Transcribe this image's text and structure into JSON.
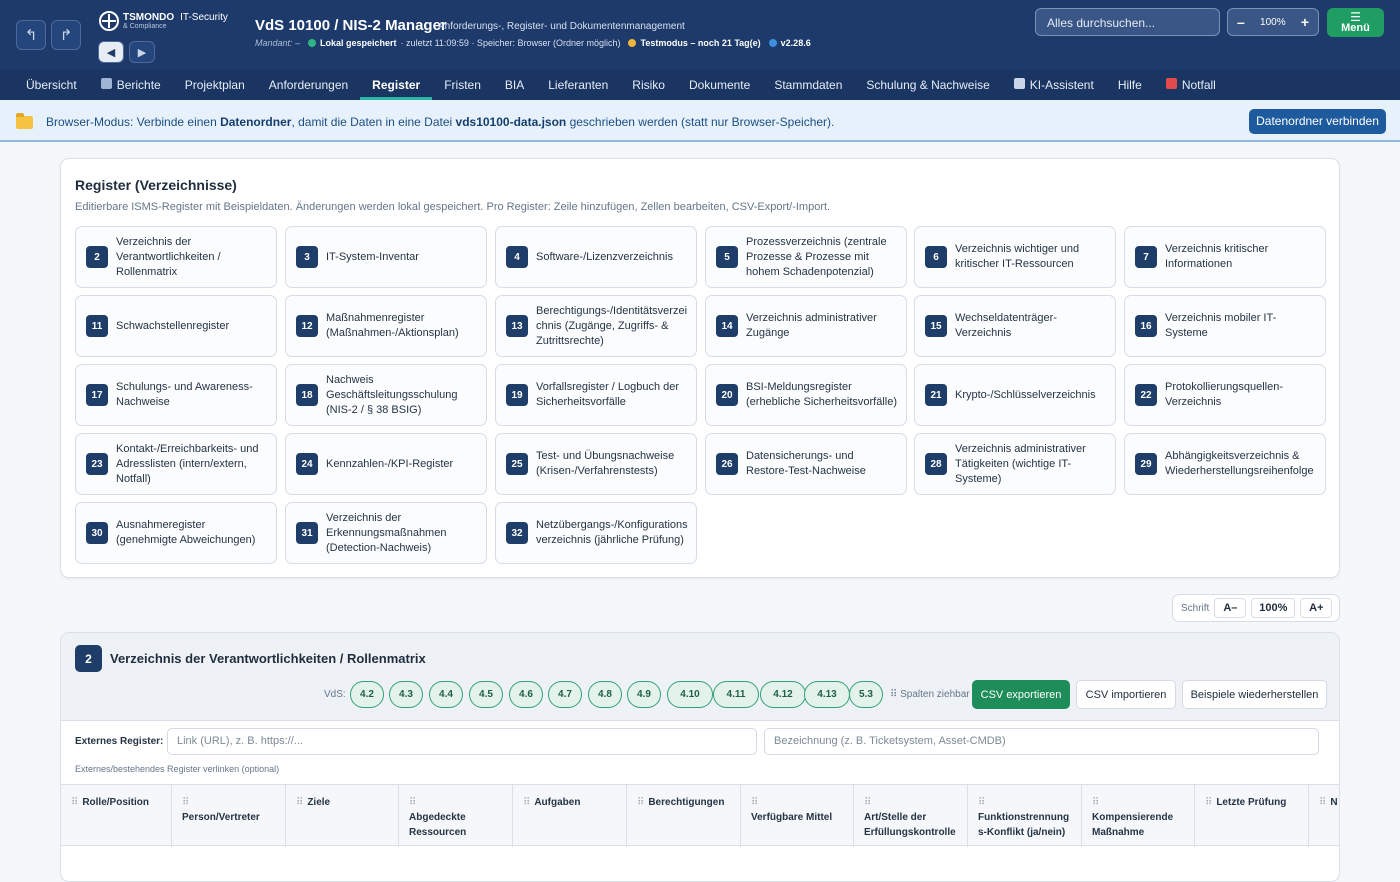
{
  "header": {
    "brand_name": "TSMONDO",
    "brand_suffix": "IT-Security",
    "brand_tagline": "& Compliance",
    "title": "VdS 10100 / NIS-2 Manager",
    "subtitle": "Anforderungs-, Register- und Dokumentenmanagement",
    "mandant": "Mandant: –",
    "status_saved": "Lokal gespeichert",
    "status_time": "· zuletzt 11:09:59 · Speicher: Browser (Ordner möglich)",
    "status_test": "Testmodus – noch 21 Tag(e)",
    "version": "v2.28.6",
    "search_placeholder": "Alles durchsuchen...",
    "zoom_minus": "–",
    "zoom_value": "100%",
    "zoom_plus": "+",
    "menu_label": "Menü",
    "colors": {
      "saved": "#2fb486",
      "test": "#f2b53c",
      "version": "#3f8fdc"
    }
  },
  "tabs": [
    {
      "label": "Übersicht",
      "icon": ""
    },
    {
      "label": "Berichte",
      "icon": "chart-icon"
    },
    {
      "label": "Projektplan",
      "icon": ""
    },
    {
      "label": "Anforderungen",
      "icon": ""
    },
    {
      "label": "Register",
      "icon": "",
      "active": true
    },
    {
      "label": "Fristen",
      "icon": ""
    },
    {
      "label": "BIA",
      "icon": ""
    },
    {
      "label": "Lieferanten",
      "icon": ""
    },
    {
      "label": "Risiko",
      "icon": ""
    },
    {
      "label": "Dokumente",
      "icon": ""
    },
    {
      "label": "Stammdaten",
      "icon": ""
    },
    {
      "label": "Schulung & Nachweise",
      "icon": ""
    },
    {
      "label": "KI-Assistent",
      "icon": "robot-icon"
    },
    {
      "label": "Hilfe",
      "icon": ""
    },
    {
      "label": "Notfall",
      "icon": "siren-icon"
    }
  ],
  "banner": {
    "text_1": "Browser-Modus: Verbinde einen ",
    "text_bold_1": "Datenordner",
    "text_2": ", damit die Daten in eine Datei ",
    "text_bold_2": "vds10100-data.json",
    "text_3": " geschrieben werden (statt nur Browser-Speicher).",
    "button": "Datenordner verbinden"
  },
  "registers_card": {
    "title": "Register (Verzeichnisse)",
    "description": "Editierbare ISMS-Register mit Beispieldaten. Änderungen werden lokal gespeichert. Pro Register: Zeile hinzufügen, Zellen bearbeiten, CSV-Export/-Import.",
    "tiles": [
      {
        "num": "2",
        "label": "Verzeichnis der Verantwortlichkeiten / Rollenmatrix"
      },
      {
        "num": "3",
        "label": "IT-System-Inventar"
      },
      {
        "num": "4",
        "label": "Software-/Lizenzverzeichnis"
      },
      {
        "num": "5",
        "label": "Prozessverzeichnis (zentrale Prozesse & Prozesse mit hohem Schadenpotenzial)"
      },
      {
        "num": "6",
        "label": "Verzeichnis wichtiger und kritischer IT-Ressourcen"
      },
      {
        "num": "7",
        "label": "Verzeichnis kritischer Informationen"
      },
      {
        "num": "11",
        "label": "Schwachstellenregister"
      },
      {
        "num": "12",
        "label": "Maßnahmenregister (Maßnahmen-/Aktionsplan)"
      },
      {
        "num": "13",
        "label": "Berechtigungs-/Identitätsverzeichnis (Zugänge, Zugriffs- & Zutrittsrechte)"
      },
      {
        "num": "14",
        "label": "Verzeichnis administrativer Zugänge"
      },
      {
        "num": "15",
        "label": "Wechseldatenträger-Verzeichnis"
      },
      {
        "num": "16",
        "label": "Verzeichnis mobiler IT-Systeme"
      },
      {
        "num": "17",
        "label": "Schulungs- und Awareness-Nachweise"
      },
      {
        "num": "18",
        "label": "Nachweis Geschäftsleitungsschulung (NIS-2 / § 38 BSIG)"
      },
      {
        "num": "19",
        "label": "Vorfallsregister / Logbuch der Sicherheitsvorfälle"
      },
      {
        "num": "20",
        "label": "BSI-Meldungsregister (erhebliche Sicherheitsvorfälle)"
      },
      {
        "num": "21",
        "label": "Krypto-/Schlüsselverzeichnis"
      },
      {
        "num": "22",
        "label": "Protokollierungsquellen-Verzeichnis"
      },
      {
        "num": "23",
        "label": "Kontakt-/Erreichbarkeits- und Adresslisten (intern/extern, Notfall)"
      },
      {
        "num": "24",
        "label": "Kennzahlen-/KPI-Register"
      },
      {
        "num": "25",
        "label": "Test- und Übungsnachweise (Krisen-/Verfahrenstests)"
      },
      {
        "num": "26",
        "label": "Datensicherungs- und Restore-Test-Nachweise"
      },
      {
        "num": "28",
        "label": "Verzeichnis administrativer Tätigkeiten (wichtige IT-Systeme)"
      },
      {
        "num": "29",
        "label": "Abhängigkeitsverzeichnis & Wiederherstellungsreihenfolge"
      },
      {
        "num": "30",
        "label": "Ausnahmeregister (genehmigte Abweichungen)"
      },
      {
        "num": "31",
        "label": "Verzeichnis der Erkennungsmaßnahmen (Detection-Nachweis)"
      },
      {
        "num": "32",
        "label": "Netzübergangs-/Konfigurationsverzeichnis (jährliche Prüfung)"
      }
    ]
  },
  "font_control": {
    "label": "Schrift",
    "minus": "A–",
    "value": "100%",
    "plus": "A+"
  },
  "register_detail": {
    "num": "2",
    "title": "Verzeichnis der Verantwortlichkeiten / Rollenmatrix",
    "vds_label": "VdS:",
    "vds_chips": [
      "4.2",
      "4.3",
      "4.4",
      "4.5",
      "4.6",
      "4.7",
      "4.8",
      "4.9",
      "4.10",
      "4.11",
      "4.12",
      "4.13",
      "5.3"
    ],
    "drag_hint": "⠿ Spalten ziehbar",
    "btn_export": "CSV exportieren",
    "btn_import": "CSV importieren",
    "btn_restore": "Beispiele wiederherstellen",
    "external_label": "Externes Register:",
    "external_link_placeholder": "Link (URL), z. B. https://...",
    "external_name_placeholder": "Bezeichnung (z. B. Ticketsystem, Asset-CMDB)",
    "external_hint": "Externes/bestehendes Register verlinken (optional)",
    "columns": [
      "Rolle/Position",
      "Person/Vertreter",
      "Ziele",
      "Abgedeckte Ressourcen",
      "Aufgaben",
      "Berechtigungen",
      "Verfügbare Mittel",
      "Art/Stelle der Erfüllungskontrolle",
      "Funktionstrennung s-Konflikt (ja/nein)",
      "Kompensierende Maßnahme",
      "Letzte Prüfung",
      "N"
    ]
  }
}
